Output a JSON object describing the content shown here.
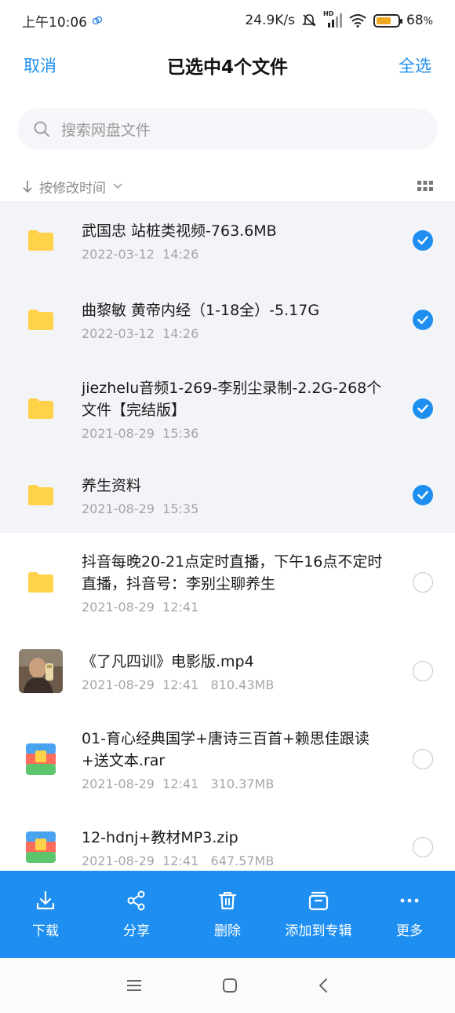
{
  "status": {
    "time": "上午10:06",
    "speed": "24.9K/s",
    "battery": "68",
    "battery_pct_sign": "%",
    "hd_label": "HD",
    "battery_level": 0.68
  },
  "header": {
    "cancel_label": "取消",
    "title": "已选中4个文件",
    "select_all_label": "全选"
  },
  "search": {
    "placeholder": "搜索网盘文件"
  },
  "sort": {
    "label": "按修改时间"
  },
  "files": [
    {
      "name": "武国忠  站桩类视频-763.6MB",
      "date": "2022-03-12  14:26",
      "selected": true,
      "type": "folder-icon"
    },
    {
      "name": "曲黎敏   黄帝内经（1-18全）-5.17G",
      "date": "2022-03-12  14:26",
      "selected": true,
      "type": "folder-icon"
    },
    {
      "name": "jiezhelu音频1-269-李别尘录制-2.2G-268个文件【完结版】",
      "date": "2021-08-29  15:36",
      "selected": true,
      "type": "folder-icon"
    },
    {
      "name": "养生资料",
      "date": "2021-08-29  15:35",
      "selected": true,
      "type": "folder-icon"
    },
    {
      "name": "抖音每晚20-21点定时直播，下午16点不定时直播，抖音号：李别尘聊养生",
      "date": "2021-08-29  12:41",
      "selected": false,
      "type": "folder-icon"
    },
    {
      "name": "《了凡四训》电影版.mp4",
      "date": "2021-08-29  12:41   810.43MB",
      "selected": false,
      "type": "video-thumbnail"
    },
    {
      "name": "01-育心经典国学+唐诗三百首+赖思佳跟读+送文本.rar",
      "date": "2021-08-29  12:41   310.37MB",
      "selected": false,
      "type": "archive-icon"
    },
    {
      "name": "12-hdnj+教材MP3.zip",
      "date": "2021-08-29  12:41   647.57MB",
      "selected": false,
      "type": "archive-icon"
    }
  ],
  "actions": [
    {
      "label": "下载",
      "icon": "download-icon"
    },
    {
      "label": "分享",
      "icon": "share-icon"
    },
    {
      "label": "删除",
      "icon": "trash-icon"
    },
    {
      "label": "添加到专辑",
      "icon": "album-icon"
    },
    {
      "label": "更多",
      "icon": "more-icon"
    }
  ],
  "colors": {
    "accent": "#1e8ff0",
    "selected_row_bg": "#f3f4f8",
    "folder": "#ffd24a"
  }
}
